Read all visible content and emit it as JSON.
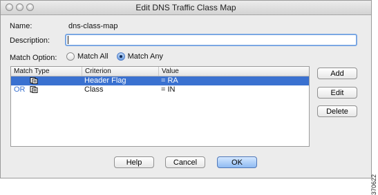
{
  "window": {
    "title": "Edit DNS Traffic Class Map"
  },
  "form": {
    "name_label": "Name:",
    "name_value": "dns-class-map",
    "description_label": "Description:",
    "description_value": "",
    "match_option_label": "Match Option:",
    "match_all_label": "Match All",
    "match_any_label": "Match Any",
    "selected_option": "Match Any"
  },
  "table": {
    "columns": [
      "Match Type",
      "Criterion",
      "Value"
    ],
    "rows": [
      {
        "match_type": "",
        "icon": "match-rule-icon",
        "criterion": "Header Flag",
        "value": "= RA",
        "selected": true
      },
      {
        "match_type": "OR",
        "icon": "match-rule-icon",
        "criterion": "Class",
        "value": "= IN",
        "selected": false
      }
    ]
  },
  "side_buttons": {
    "add": "Add",
    "edit": "Edit",
    "delete": "Delete"
  },
  "footer": {
    "help": "Help",
    "cancel": "Cancel",
    "ok": "OK"
  },
  "figure_id": "370622",
  "colors": {
    "selection": "#3a71d0",
    "focus_ring": "#7aa7e3",
    "default_button": "#8fbaf2"
  }
}
